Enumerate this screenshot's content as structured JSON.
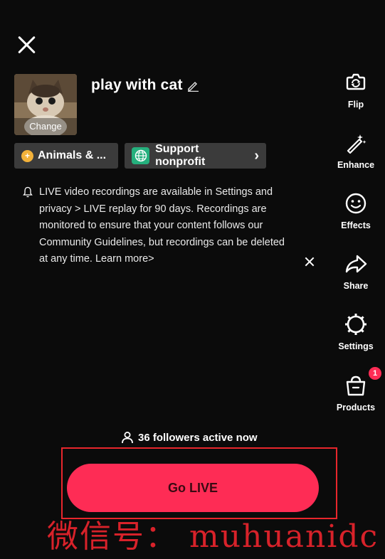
{
  "header": {
    "close_icon": "close-icon"
  },
  "cover": {
    "change_label": "Change"
  },
  "title": {
    "text": "play with cat"
  },
  "chips": {
    "topic_label": "Animals & ...",
    "nonprofit_label": "Support nonprofit",
    "nonprofit_chevron": "›"
  },
  "notice": {
    "text": "LIVE video recordings are available in Settings and privacy > LIVE replay for 90 days. Recordings are monitored to ensure that your content follows our Community Guidelines, but recordings can be deleted at any time. Learn more>"
  },
  "rail": {
    "flip": "Flip",
    "enhance": "Enhance",
    "effects": "Effects",
    "share": "Share",
    "settings": "Settings",
    "products": "Products",
    "products_badge": "1"
  },
  "footer": {
    "followers": "36 followers active now",
    "go_live": "Go LIVE"
  },
  "watermark": "微信号：  muhuanidc",
  "colors": {
    "accent": "#fe2c55",
    "highlight": "#e8262c",
    "chip_bg": "#3b3b3b"
  }
}
